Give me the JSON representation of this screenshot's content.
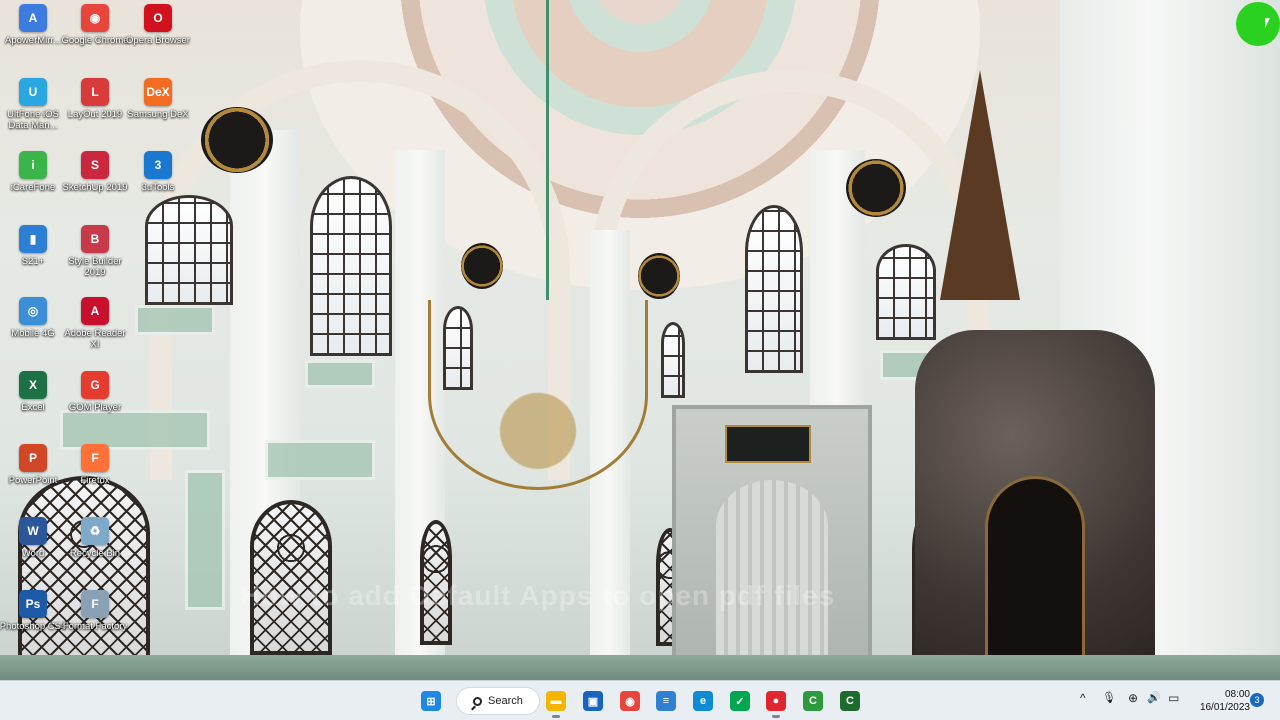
{
  "desktop": {
    "icons": [
      {
        "label": "ApowerMirr...",
        "icon": "apowermirror-icon",
        "color": "#3c7be0",
        "glyph": "A"
      },
      {
        "label": "Google Chrome",
        "icon": "chrome-icon",
        "color": "#e8453c",
        "glyph": "◉"
      },
      {
        "label": "Opera Browser",
        "icon": "opera-icon",
        "color": "#d0121c",
        "glyph": "O"
      },
      {
        "label": "UltFone iOS Data Man...",
        "icon": "ultfone-icon",
        "color": "#2aa7e0",
        "glyph": "U"
      },
      {
        "label": "LayOut 2019",
        "icon": "layout-icon",
        "color": "#d93b3b",
        "glyph": "L"
      },
      {
        "label": "Samsung DeX",
        "icon": "samsung-dex-icon",
        "color": "#f26c21",
        "glyph": "DeX"
      },
      {
        "label": "iCareFone",
        "icon": "icarefone-icon",
        "color": "#39b54a",
        "glyph": "i"
      },
      {
        "label": "SketchUp 2019",
        "icon": "sketchup-icon",
        "color": "#c9283e",
        "glyph": "S"
      },
      {
        "label": "3uTools",
        "icon": "3utools-icon",
        "color": "#1b78d0",
        "glyph": "3"
      },
      {
        "label": "S21+",
        "icon": "s21-icon",
        "color": "#2d7fd6",
        "glyph": "▮"
      },
      {
        "label": "Style Builder 2019",
        "icon": "style-builder-icon",
        "color": "#c73a4a",
        "glyph": "B"
      },
      {
        "label": "Mobile 4G",
        "icon": "mobile-4g-icon",
        "color": "#3b8fd6",
        "glyph": "◎"
      },
      {
        "label": "Adobe Reader XI",
        "icon": "adobe-reader-icon",
        "color": "#c8102e",
        "glyph": "A"
      },
      {
        "label": "Excel",
        "icon": "excel-icon",
        "color": "#1e7145",
        "glyph": "X"
      },
      {
        "label": "GOM Player",
        "icon": "gom-player-icon",
        "color": "#e63c2f",
        "glyph": "G"
      },
      {
        "label": "PowerPoint",
        "icon": "powerpoint-icon",
        "color": "#d24726",
        "glyph": "P"
      },
      {
        "label": "Firefox",
        "icon": "firefox-icon",
        "color": "#ff7139",
        "glyph": "F"
      },
      {
        "label": "Word",
        "icon": "word-icon",
        "color": "#2b579a",
        "glyph": "W"
      },
      {
        "label": "Recycle Bin",
        "icon": "recycle-bin-icon",
        "color": "#7fa9c9",
        "glyph": "♻"
      },
      {
        "label": "Photoshop CS4",
        "icon": "photoshop-icon",
        "color": "#1c5aa8",
        "glyph": "Ps"
      },
      {
        "label": "Format Factory",
        "icon": "format-factory-icon",
        "color": "#8aa0b5",
        "glyph": "F"
      }
    ]
  },
  "wallpaper": {
    "overlay_text": "How to add Default Apps to open pdf files"
  },
  "taskbar": {
    "search_label": "Search",
    "apps": [
      {
        "name": "start-button",
        "icon": "windows-icon",
        "color": "#1e88e5",
        "glyph": "⊞",
        "running": false
      },
      {
        "name": "taskbar-file-explorer",
        "icon": "folder-icon",
        "color": "#f4b400",
        "glyph": "▬",
        "running": true
      },
      {
        "name": "taskbar-store",
        "icon": "store-icon",
        "color": "#1565c0",
        "glyph": "▣",
        "running": false
      },
      {
        "name": "taskbar-chrome",
        "icon": "chrome-icon",
        "color": "#e8453c",
        "glyph": "◉",
        "running": false
      },
      {
        "name": "taskbar-notepad",
        "icon": "notepad-icon",
        "color": "#2f80d1",
        "glyph": "≡",
        "running": false
      },
      {
        "name": "taskbar-edge",
        "icon": "edge-icon",
        "color": "#0f8bd4",
        "glyph": "e",
        "running": false
      },
      {
        "name": "taskbar-kaspersky",
        "icon": "shield-check-icon",
        "color": "#00a650",
        "glyph": "✓",
        "running": false
      },
      {
        "name": "taskbar-recorder",
        "icon": "recorder-icon",
        "color": "#e0262e",
        "glyph": "●",
        "running": true
      },
      {
        "name": "taskbar-camtasia",
        "icon": "camtasia-icon",
        "color": "#2c9a3d",
        "glyph": "C",
        "running": false
      },
      {
        "name": "taskbar-camtasia-2",
        "icon": "camtasia-editor-icon",
        "color": "#1e6b2e",
        "glyph": "C",
        "running": false
      }
    ],
    "tray": {
      "chevron": "^",
      "mic": "🎙",
      "network": "⊕",
      "volume": "🔊",
      "battery": "▭"
    },
    "clock_time": "08:00",
    "clock_date": "16/01/2023",
    "notification_count": "3"
  }
}
